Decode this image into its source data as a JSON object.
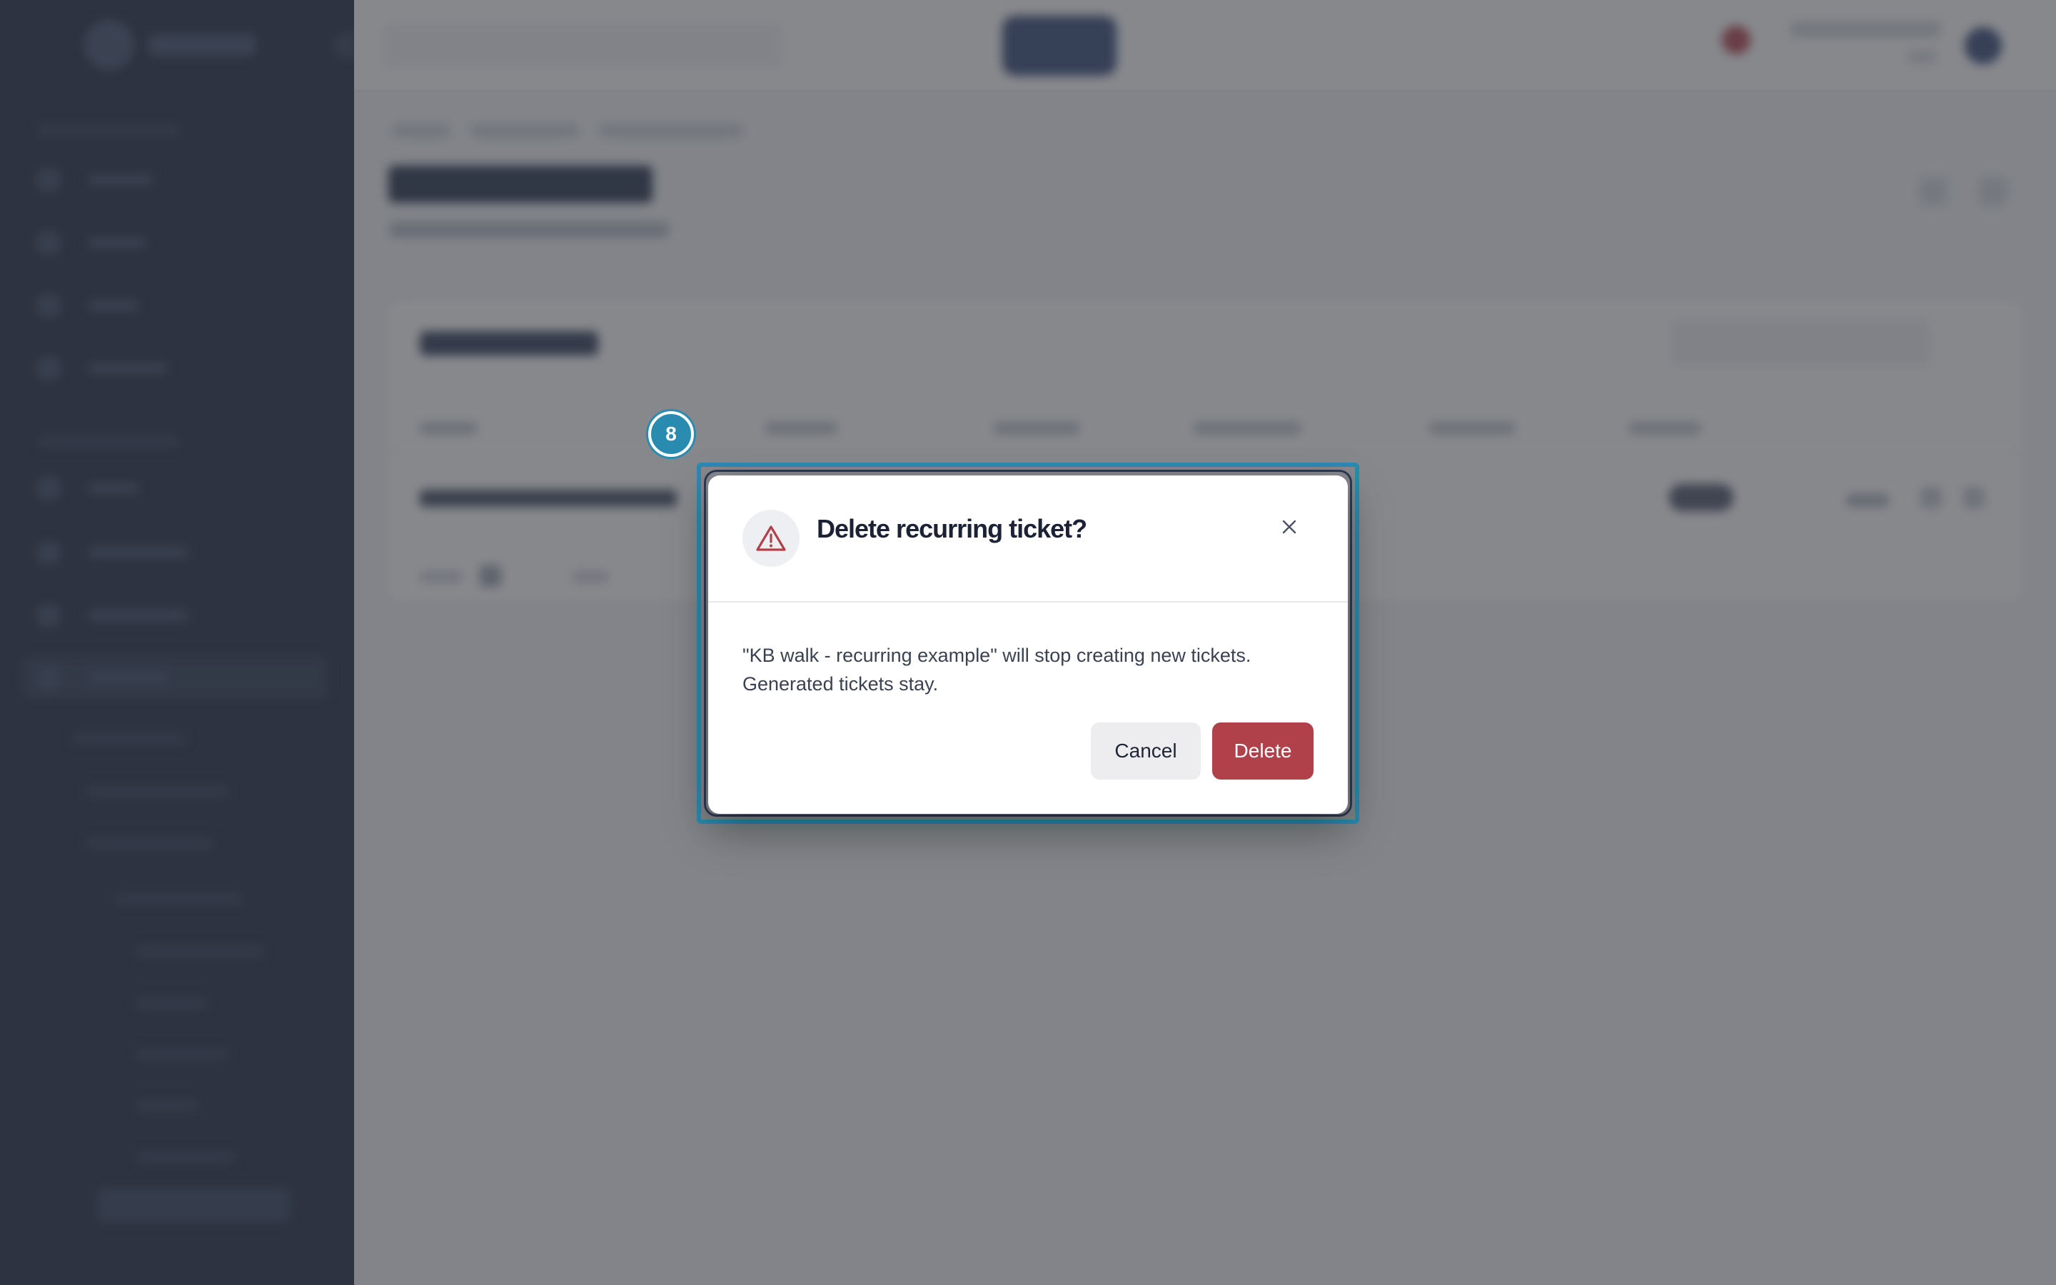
{
  "dialog": {
    "step_badge": "8",
    "title": "Delete recurring ticket?",
    "icon": "warning-triangle-icon",
    "close_icon": "close-icon",
    "body_line1": "\"KB walk - recurring example\" will stop creating new tickets.",
    "body_line2": "Generated tickets stay.",
    "cancel_label": "Cancel",
    "delete_label": "Delete"
  },
  "colors": {
    "accent": "#2a8bb0",
    "danger": "#b0414a",
    "sidebar": "#162037",
    "overlay": "rgba(60, 63, 70, 0.62)"
  }
}
